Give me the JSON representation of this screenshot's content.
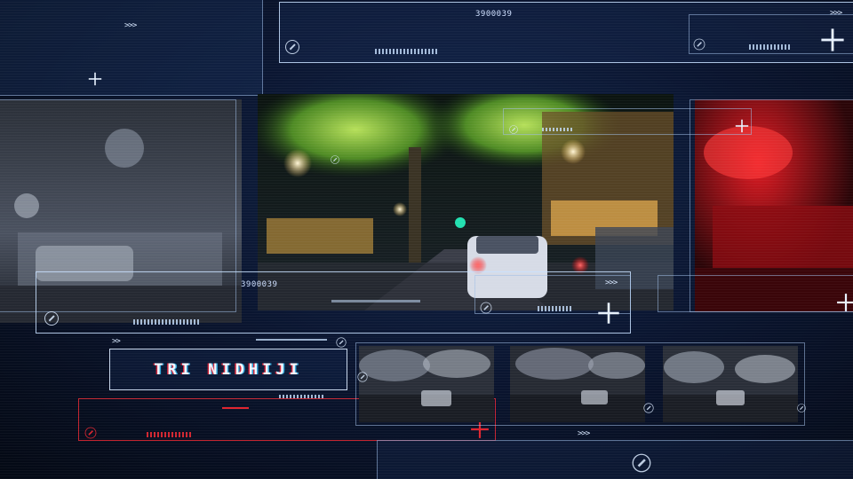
{
  "title": {
    "text": "TRI NIDHIJI"
  },
  "readouts": {
    "top_code": "3900039",
    "main_code": "3900039",
    "top_chevrons": ">>>",
    "main_chevrons": ">>>",
    "small_chevrons": ">>"
  },
  "colors": {
    "accent": "#cfe0ff",
    "red_accent": "#e02530",
    "background": "#0a1530"
  },
  "icons": [
    "target-ring-icon",
    "crosshair-plus-icon",
    "chevron-arrows-icon"
  ]
}
